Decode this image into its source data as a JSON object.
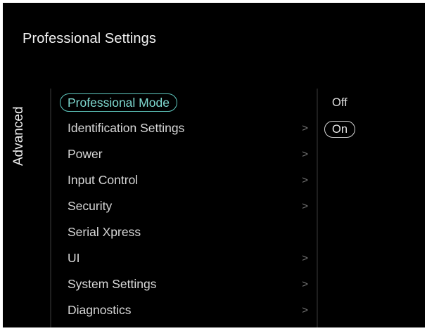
{
  "header": {
    "title": "Professional Settings"
  },
  "side_tab": {
    "label": "Advanced"
  },
  "menu": {
    "items": [
      {
        "label": "Professional Mode",
        "has_submenu": false,
        "selected": true
      },
      {
        "label": "Identification Settings",
        "has_submenu": true,
        "selected": false
      },
      {
        "label": "Power",
        "has_submenu": true,
        "selected": false
      },
      {
        "label": "Input Control",
        "has_submenu": true,
        "selected": false
      },
      {
        "label": "Security",
        "has_submenu": true,
        "selected": false
      },
      {
        "label": "Serial Xpress",
        "has_submenu": false,
        "selected": false
      },
      {
        "label": "UI",
        "has_submenu": true,
        "selected": false
      },
      {
        "label": "System Settings",
        "has_submenu": true,
        "selected": false
      },
      {
        "label": "Diagnostics",
        "has_submenu": true,
        "selected": false
      }
    ],
    "chevron_glyph": ">"
  },
  "options": {
    "items": [
      {
        "label": "Off",
        "selected": false
      },
      {
        "label": "On",
        "selected": true
      }
    ]
  },
  "colors": {
    "background": "#000000",
    "accent": "#5fc9c0",
    "text": "#d8d8d8"
  }
}
